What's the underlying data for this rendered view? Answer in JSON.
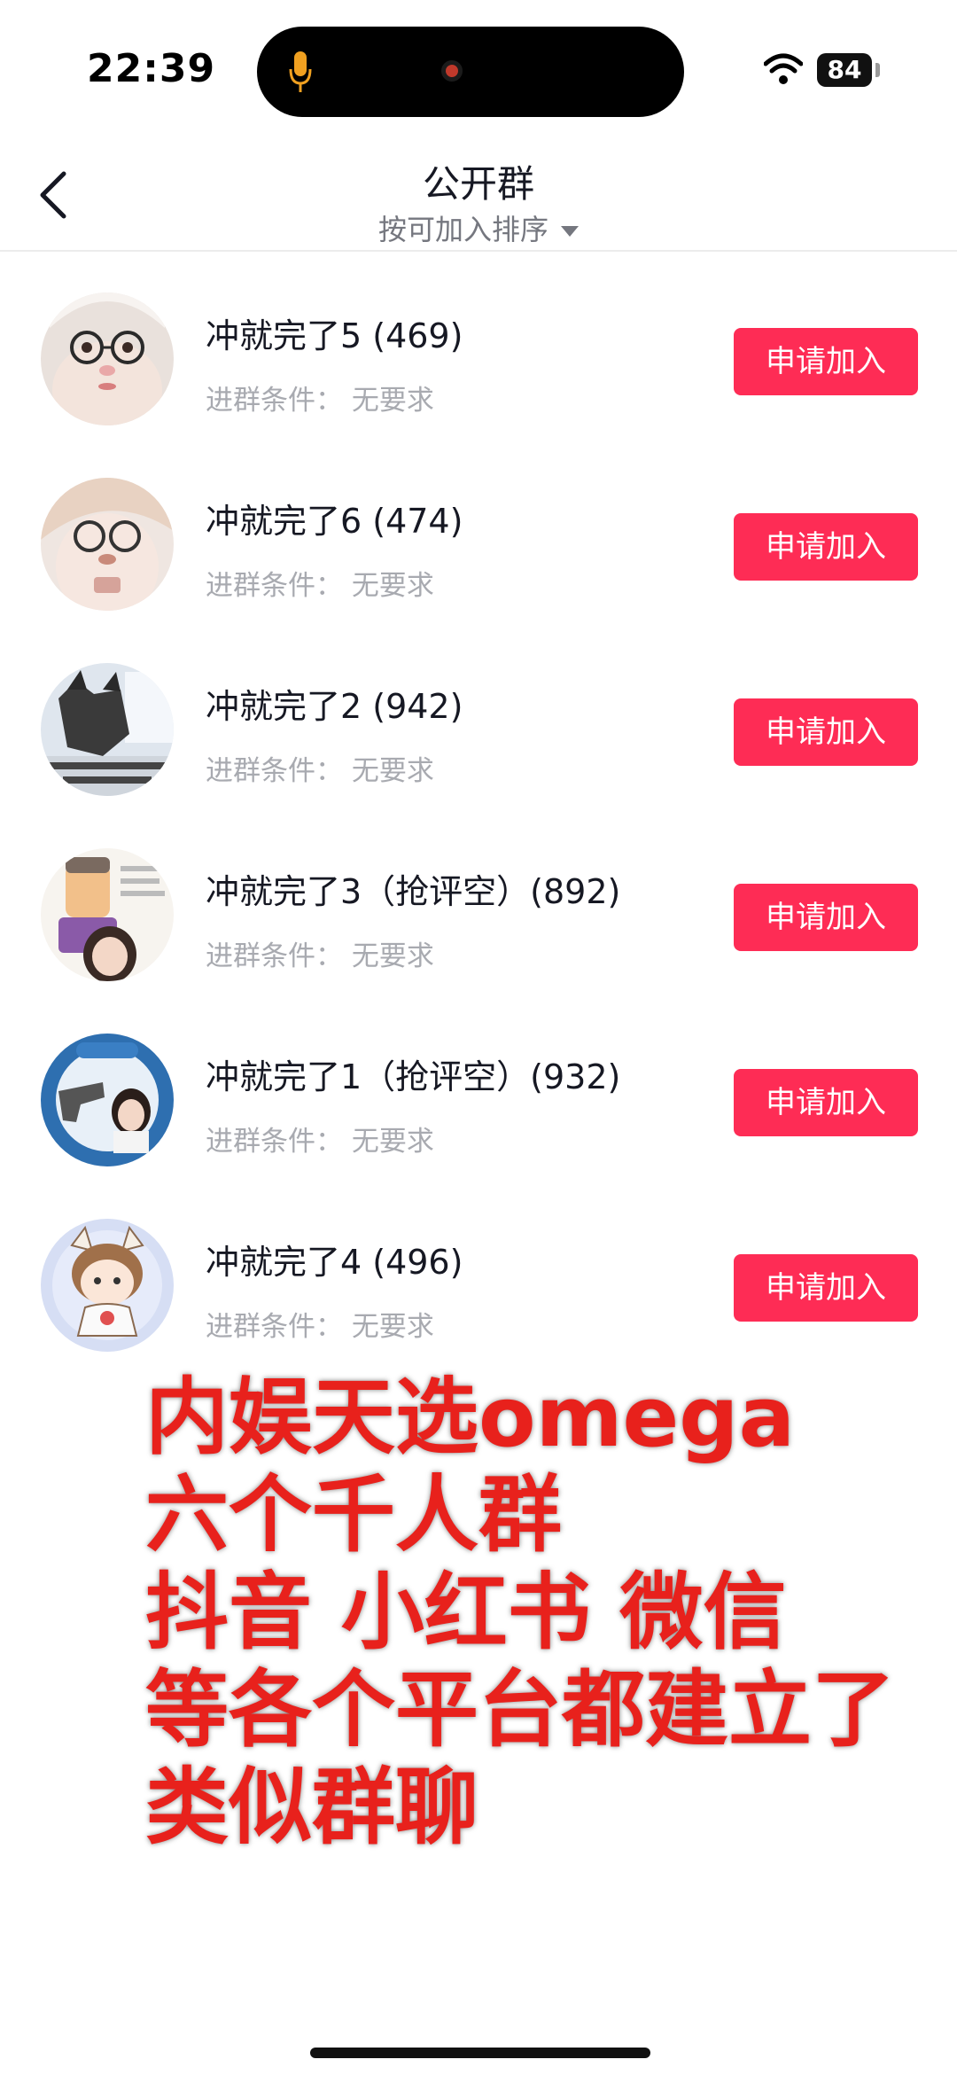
{
  "status_bar": {
    "time": "22:39",
    "battery": "84"
  },
  "nav": {
    "title": "公开群",
    "sort_label": "按可加入排序"
  },
  "groups": [
    {
      "name": "冲就完了5 (469)",
      "condition": "进群条件：  无要求",
      "button": "申请加入"
    },
    {
      "name": "冲就完了6 (474)",
      "condition": "进群条件：  无要求",
      "button": "申请加入"
    },
    {
      "name": "冲就完了2 (942)",
      "condition": "进群条件：  无要求",
      "button": "申请加入"
    },
    {
      "name": "冲就完了3（抢评空）(892)",
      "condition": "进群条件：  无要求",
      "button": "申请加入"
    },
    {
      "name": "冲就完了1（抢评空）(932)",
      "condition": "进群条件：  无要求",
      "button": "申请加入"
    },
    {
      "name": "冲就完了4 (496)",
      "condition": "进群条件：  无要求",
      "button": "申请加入"
    }
  ],
  "overlay_caption": [
    "内娱天选omega",
    "六个千人群",
    "抖音 小红书 微信",
    "等各个平台都建立了",
    "类似群聊"
  ],
  "colors": {
    "accent": "#fe2c55",
    "caption": "#e8211c"
  }
}
